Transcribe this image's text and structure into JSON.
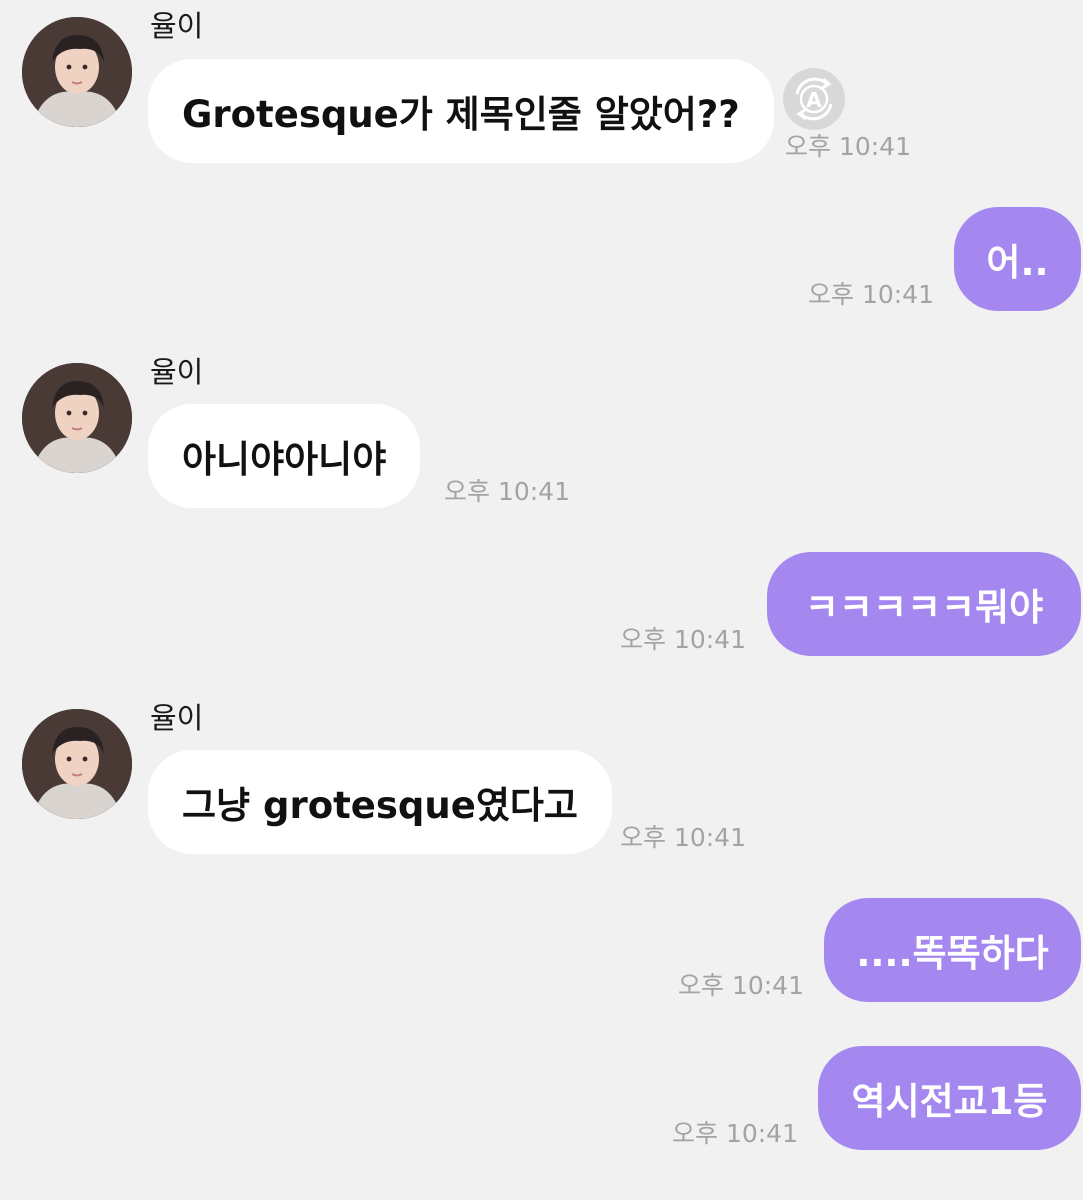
{
  "messages": [
    {
      "direction": "in",
      "sender": "율이",
      "text": "Grotesque가 제목인줄 알았어??",
      "time": "오후 10:41"
    },
    {
      "direction": "out",
      "text": "어..",
      "time": "오후 10:41"
    },
    {
      "direction": "in",
      "sender": "율이",
      "text": "아니야아니야",
      "time": "오후 10:41"
    },
    {
      "direction": "out",
      "text": "ㅋㅋㅋㅋㅋ뭐야",
      "time": "오후 10:41"
    },
    {
      "direction": "in",
      "sender": "율이",
      "text": "그냥 grotesque였다고",
      "time": "오후 10:41"
    },
    {
      "direction": "out",
      "text": "....똑똑하다",
      "time": "오후 10:41"
    },
    {
      "direction": "out",
      "text": "역시전교1등",
      "time": "오후 10:41"
    }
  ],
  "translate_button": {
    "icon": "auto-translate-icon",
    "glyph": "A"
  },
  "colors": {
    "background": "#f1f1f1",
    "incoming_bubble": "#ffffff",
    "outgoing_bubble": "#a488ef",
    "timestamp": "#a3a3a3"
  }
}
